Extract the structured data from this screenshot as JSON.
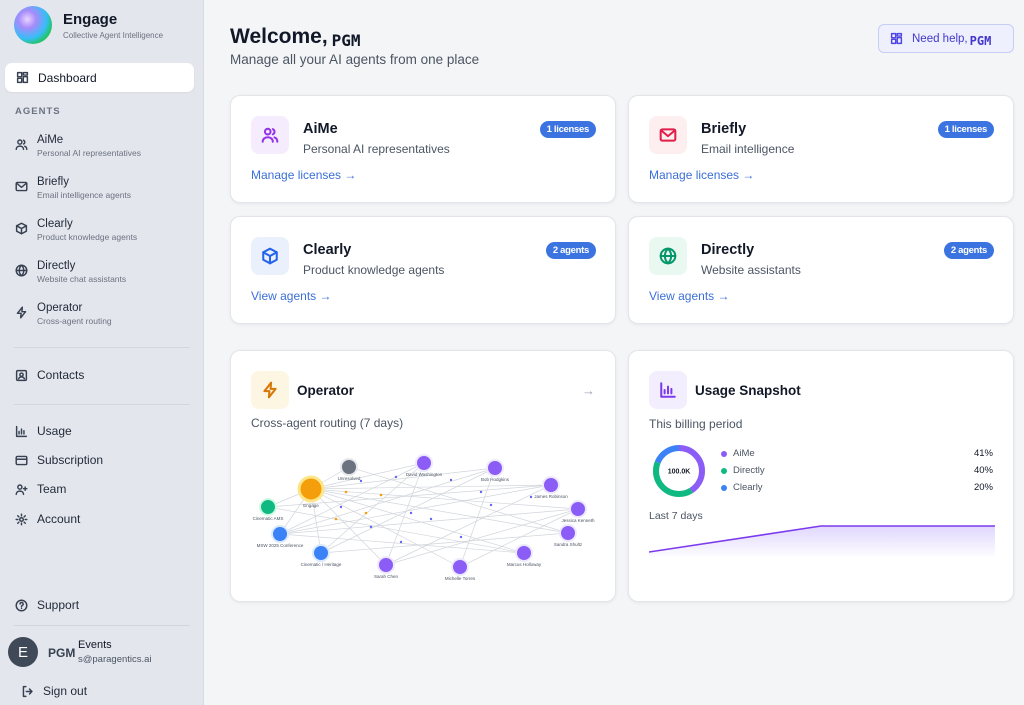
{
  "app": {
    "title": "Engage",
    "subtitle": "Collective Agent Intelligence"
  },
  "sidebar": {
    "dashboard_label": "Dashboard",
    "agents_section_label": "AGENTS",
    "agents": [
      {
        "name": "AiMe",
        "desc": "Personal AI representatives",
        "icon": "users-icon"
      },
      {
        "name": "Briefly",
        "desc": "Email intelligence agents",
        "icon": "mail-icon"
      },
      {
        "name": "Clearly",
        "desc": "Product knowledge agents",
        "icon": "cube-icon"
      },
      {
        "name": "Directly",
        "desc": "Website chat assistants",
        "icon": "globe-icon"
      },
      {
        "name": "Operator",
        "desc": "Cross-agent routing",
        "icon": "bolt-icon"
      }
    ],
    "contacts_label": "Contacts",
    "usage_label": "Usage",
    "subscription_label": "Subscription",
    "team_label": "Team",
    "account_label": "Account",
    "support_label": "Support",
    "user": {
      "initial": "E",
      "name": "PGM",
      "event_label": "Events",
      "email": "s@paragentics.ai"
    },
    "signout_label": "Sign out"
  },
  "header": {
    "welcome": "Welcome,",
    "welcome_name": "PGM",
    "subtitle": "Manage all your AI agents from one place",
    "help_label": "Need help,",
    "help_user": "PGM"
  },
  "cards": {
    "aime": {
      "title": "AiMe",
      "subtitle": "Personal AI representatives",
      "badge": "1 licenses",
      "link": "Manage licenses →"
    },
    "briefly": {
      "title": "Briefly",
      "subtitle": "Email intelligence",
      "badge": "1 licenses",
      "link": "Manage licenses →"
    },
    "clearly": {
      "title": "Clearly",
      "subtitle": "Product knowledge agents",
      "badge": "2 agents",
      "link": "View agents →"
    },
    "directly": {
      "title": "Directly",
      "subtitle": "Website assistants",
      "badge": "2 agents",
      "link": "View agents →"
    }
  },
  "operator": {
    "title": "Operator",
    "subtitle": "Cross-agent routing (7 days)",
    "arrow": "→",
    "graph_labels": [
      "Unresolved",
      "David Washington",
      "Bob Hodgkins",
      "James Robinson",
      "Jessica Kenneth",
      "Sandra Shultz",
      "Marcus Holloway",
      "Michelle Torres",
      "Sarah Chen",
      "Cinematic / Heritage",
      "MSW 2025 Conference",
      "Cinematic AMS",
      "Engage"
    ]
  },
  "usage": {
    "title": "Usage Snapshot",
    "subtitle": "This billing period",
    "total": "100.0K",
    "legend": [
      {
        "name": "AiMe",
        "pct": "41%",
        "color": "#8b5cf6"
      },
      {
        "name": "Directly",
        "pct": "40%",
        "color": "#10b981"
      },
      {
        "name": "Clearly",
        "pct": "20%",
        "color": "#3b82f6"
      }
    ],
    "trend_label": "Last 7 days"
  },
  "colors": {
    "accent": "#3b74e0",
    "violet": "#7c3aed"
  }
}
